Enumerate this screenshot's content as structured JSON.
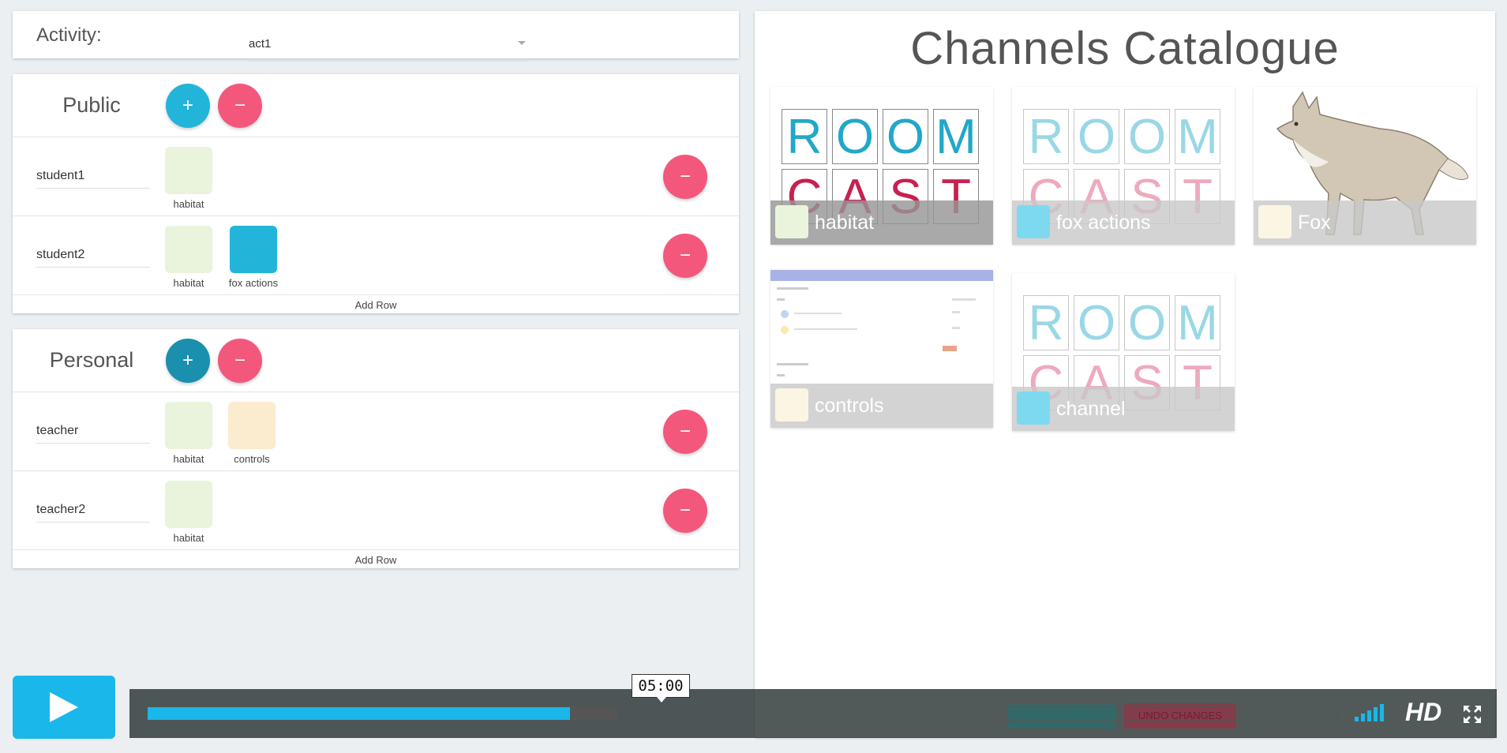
{
  "activity": {
    "label": "Activity:",
    "value": "act1"
  },
  "public_panel": {
    "title": "Public",
    "add_symbol": "+",
    "remove_symbol": "−",
    "rows": [
      {
        "name": "student1",
        "chips": [
          {
            "label": "habitat",
            "color": "#eaf4dc"
          }
        ]
      },
      {
        "name": "student2",
        "chips": [
          {
            "label": "habitat",
            "color": "#eaf4dc"
          },
          {
            "label": "fox actions",
            "color": "#22b5d9"
          }
        ]
      }
    ],
    "add_row_label": "Add Row"
  },
  "personal_panel": {
    "title": "Personal",
    "add_symbol": "+",
    "remove_symbol": "−",
    "rows": [
      {
        "name": "teacher",
        "chips": [
          {
            "label": "habitat",
            "color": "#eaf4dc"
          },
          {
            "label": "controls",
            "color": "#fbebcf"
          }
        ]
      },
      {
        "name": "teacher2",
        "chips": [
          {
            "label": "habitat",
            "color": "#eaf4dc"
          }
        ]
      }
    ],
    "add_row_label": "Add Row"
  },
  "catalogue": {
    "title": "Channels Catalogue",
    "tiles": [
      {
        "name": "habitat",
        "color": "#eaf4dc",
        "art": "roomcast"
      },
      {
        "name": "fox actions",
        "color": "#7dd9f0",
        "art": "roomcast-faded"
      },
      {
        "name": "Fox",
        "color": "#fbf5e3",
        "art": "fox"
      },
      {
        "name": "controls",
        "color": "#fbf5e3",
        "art": "controls"
      },
      {
        "name": "channel",
        "color": "#7dd9f0",
        "art": "roomcast-faded"
      }
    ],
    "roomcast_top": [
      "R",
      "O",
      "O",
      "M"
    ],
    "roomcast_bottom": [
      "C",
      "A",
      "S",
      "T"
    ]
  },
  "actions": {
    "save_label": "SAVE CHANGES",
    "undo_label": "UNDO CHANGES"
  },
  "video": {
    "time": "05:00",
    "played_fraction": 0.355,
    "buffered_fraction": 0.395,
    "hd_label": "HD",
    "accent": "#1ab7ea"
  }
}
